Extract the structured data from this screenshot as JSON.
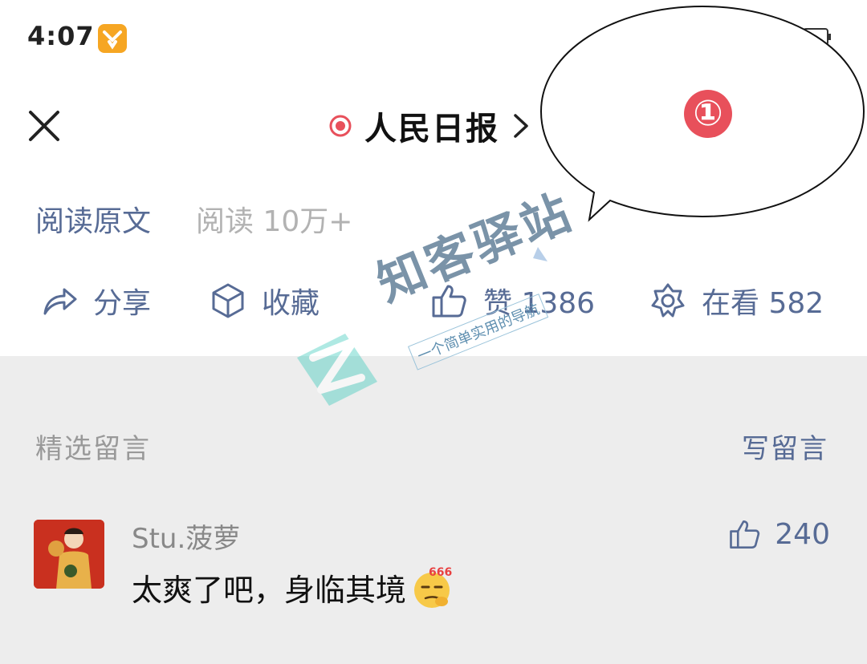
{
  "status_bar": {
    "time": "4:07"
  },
  "header": {
    "account_name": "人民日报"
  },
  "meta": {
    "read_original": "阅读原文",
    "read_count": "阅读 10万+"
  },
  "actions": {
    "share": "分享",
    "favorite": "收藏",
    "like": "赞 1386",
    "looking": "在看 582"
  },
  "comments": {
    "section_title": "精选留言",
    "write_label": "写留言",
    "items": [
      {
        "user": "Stu.菠萝",
        "text": "太爽了吧，身临其境",
        "likes": "240",
        "emoji_label": "666"
      }
    ]
  },
  "annotation": {
    "number": "①"
  },
  "watermark": {
    "title": "知客驿站",
    "subtitle": "一个简单实用的导航"
  },
  "colors": {
    "link": "#576b95",
    "muted": "#b2b2b2",
    "comment_bg": "#ededed",
    "accent_red": "#e8505b",
    "badge": "#f6a623"
  }
}
